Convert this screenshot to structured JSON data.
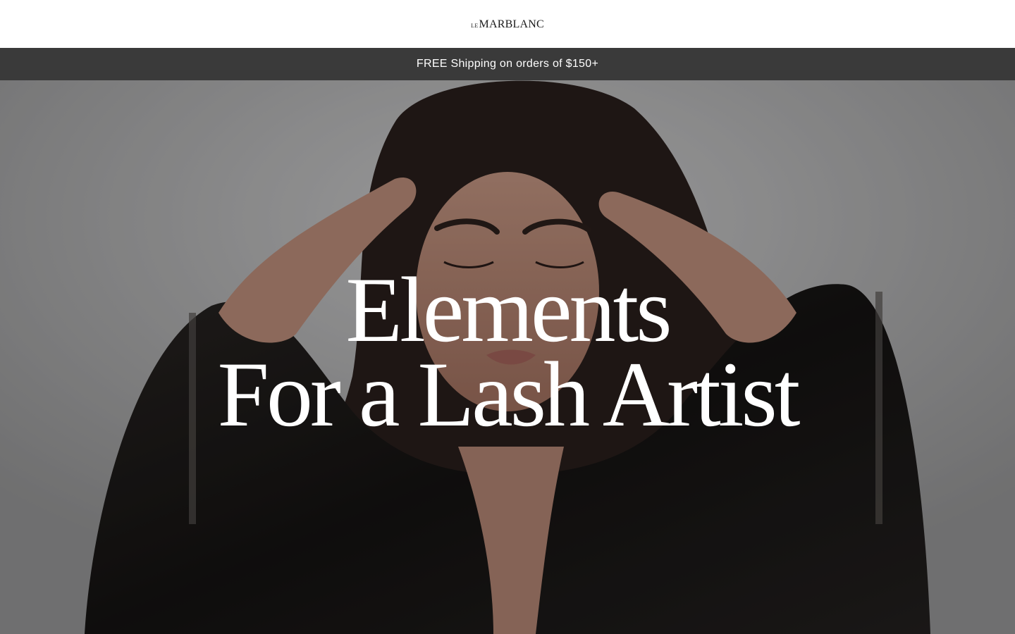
{
  "header": {
    "logo_prefix": "LE",
    "logo_name": "MARBLANC"
  },
  "announcement": {
    "text": "FREE Shipping on orders of $150+"
  },
  "hero": {
    "title_line1": "Elements",
    "title_line2": "For a Lash Artist",
    "image": "woman-with-hands-on-head-photo"
  },
  "colors": {
    "announcement_bg": "#3a3a3a",
    "header_bg": "#ffffff",
    "hero_text": "#ffffff"
  }
}
